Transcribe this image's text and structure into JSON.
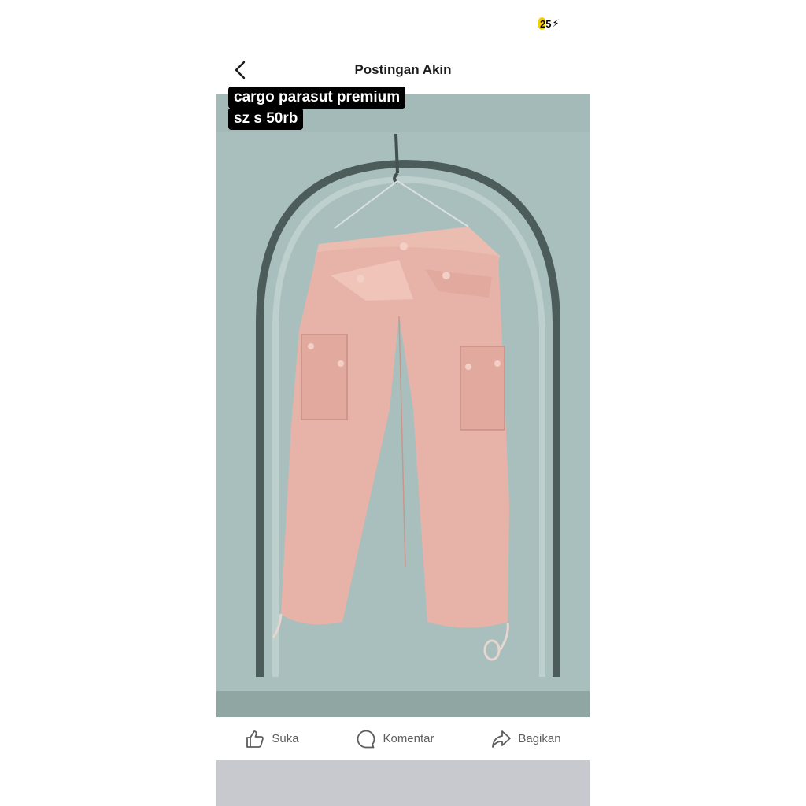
{
  "status": {
    "battery": "25"
  },
  "header": {
    "title": "Postingan Akin"
  },
  "post": {
    "caption_line1": "cargo parasut premium",
    "caption_line2": "sz s 50rb"
  },
  "actions": {
    "like_label": "Suka",
    "comment_label": "Komentar",
    "share_label": "Bagikan"
  },
  "colors": {
    "wall": "#a9bfbd",
    "pants": "#e7b3a8",
    "caption_bg": "#000000"
  }
}
